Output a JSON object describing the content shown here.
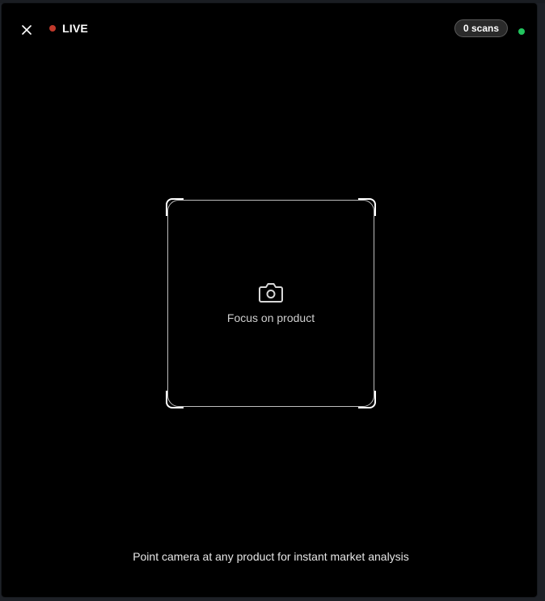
{
  "header": {
    "live_label": "LIVE",
    "scan_count": "0 scans"
  },
  "viewfinder": {
    "focus_label": "Focus on product"
  },
  "footer": {
    "hint": "Point camera at any product for instant market analysis"
  },
  "icons": {
    "close": "close-icon",
    "live": "live-dot",
    "status": "status-dot",
    "camera": "camera-icon"
  },
  "colors": {
    "background": "#000000",
    "live_dot": "#c0392b",
    "status_dot": "#22c55e",
    "text": "#ffffff",
    "frame_border": "#bdbdbd"
  }
}
